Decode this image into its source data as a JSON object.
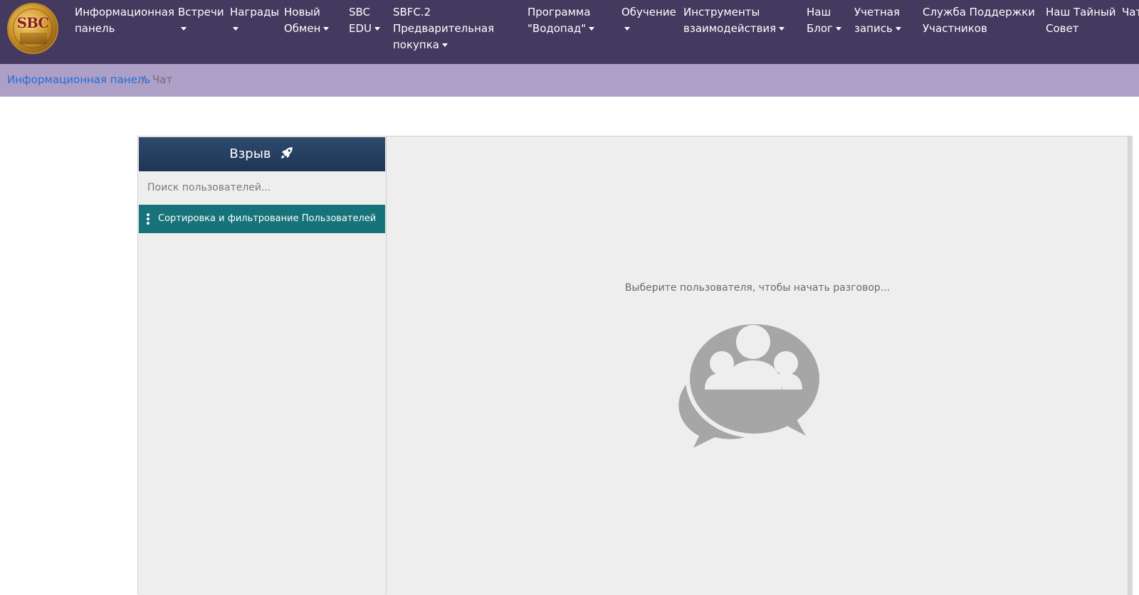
{
  "logo": {
    "text": "SBC"
  },
  "nav": {
    "items": [
      {
        "lines": [
          "Информационная",
          "панель"
        ],
        "dropdown": false
      },
      {
        "lines": [
          "Встречи"
        ],
        "dropdown": true
      },
      {
        "lines": [
          "Награды"
        ],
        "dropdown": true
      },
      {
        "lines": [
          "Новый",
          "Обмен"
        ],
        "dropdown": true
      },
      {
        "lines": [
          "SBC",
          "EDU"
        ],
        "dropdown": true
      },
      {
        "lines": [
          "SBFC.2",
          "Предварительная",
          "покупка"
        ],
        "dropdown": true
      },
      {
        "lines": [
          "Программа",
          "\"Водопад\""
        ],
        "dropdown": true
      },
      {
        "lines": [
          "Обучение"
        ],
        "dropdown": true
      },
      {
        "lines": [
          "Инструменты",
          "взаимодействия"
        ],
        "dropdown": true
      },
      {
        "lines": [
          "Наш",
          "Блог"
        ],
        "dropdown": true
      },
      {
        "lines": [
          "Учетная",
          "запись"
        ],
        "dropdown": true
      },
      {
        "lines": [
          "Служба Поддержки",
          "Участников"
        ],
        "dropdown": false
      },
      {
        "lines": [
          "Наш Тайный",
          "Совет"
        ],
        "dropdown": false
      },
      {
        "lines": [
          "Чат"
        ],
        "dropdown": false
      }
    ]
  },
  "breadcrumb": {
    "link": "Информационная панель",
    "separator": "/",
    "current": "Чат"
  },
  "sidebar": {
    "title": "Взрыв",
    "title_icon": "rocket-icon",
    "search_placeholder": "Поиск пользователей...",
    "sort_label": "Сортировка и фильтрование Пользователей",
    "sort_icon": "kebab-icon"
  },
  "main": {
    "empty_text": "Выберите пользователя, чтобы начать разговор...",
    "empty_icon": "chat-users-icon"
  },
  "colors": {
    "navbar": "#44395f",
    "breadcrumb_bg": "#ae9fc7",
    "link": "#1e6fd9",
    "sidebar_header": "#243e62",
    "sort_bar": "#16737a",
    "pane_bg": "#eeeeee",
    "icon_gray": "#a6a6a6"
  }
}
